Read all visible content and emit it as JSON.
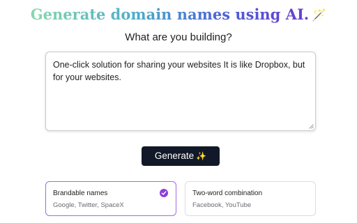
{
  "header": {
    "title_text": "Generate domain names using AI.",
    "title_icon": "🪄",
    "title_icon_name": "magic-wand-icon"
  },
  "form": {
    "prompt_label": "What are you building?",
    "description_value": "One-click solution for sharing your websites It is like Dropbox, but for your websites.",
    "generate_label": "Generate",
    "generate_icon": "✨"
  },
  "options": [
    {
      "label": "Brandable names",
      "examples": "Google, Twitter, SpaceX",
      "selected": true
    },
    {
      "label": "Two-word combination",
      "examples": "Facebook, YouTube",
      "selected": false
    }
  ],
  "colors": {
    "button_bg": "#111827",
    "selected_accent": "#8b3fd9",
    "title_gradient": [
      "#86d9ad",
      "#4ba9c9",
      "#4d5fd6",
      "#6b3bcf"
    ]
  }
}
